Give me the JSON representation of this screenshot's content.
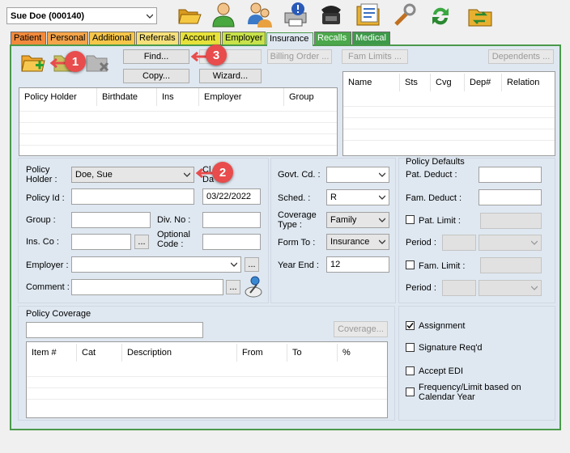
{
  "patient_selector": {
    "value": "Sue Doe (000140)"
  },
  "toolbar": {
    "icons": [
      "open-folder-icon",
      "patient-icon",
      "family-icon",
      "print-alert-icon",
      "phone-icon",
      "document-list-icon",
      "tools-icon",
      "refresh-icon",
      "transfer-folder-icon"
    ]
  },
  "tabs": [
    {
      "label": "Patient",
      "color": "#f28a3c"
    },
    {
      "label": "Personal",
      "color": "#f4a44a"
    },
    {
      "label": "Additional",
      "color": "#f6c64a"
    },
    {
      "label": "Referrals",
      "color": "#f6e07a"
    },
    {
      "label": "Account",
      "color": "#e6e23a"
    },
    {
      "label": "Employer",
      "color": "#c8e24a"
    },
    {
      "label": "Insurance",
      "color": "#dfe8f1"
    },
    {
      "label": "Recalls",
      "color": "#4aa84a"
    },
    {
      "label": "Medical",
      "color": "#3e9a4a"
    }
  ],
  "buttons": {
    "find": "Find...",
    "blank": "",
    "billing_order": "Billing Order ...",
    "fam_limits": "Fam Limits ...",
    "dependents": "Dependents ...",
    "copy": "Copy...",
    "wizard": "Wizard...",
    "coverage": "Coverage..."
  },
  "markers": {
    "one": "1",
    "two": "2",
    "three": "3"
  },
  "policy_grid": {
    "columns": [
      "Policy Holder",
      "Birthdate",
      "Ins",
      "Employer",
      "Group"
    ]
  },
  "dependents_grid": {
    "columns": [
      "Name",
      "Sts",
      "Cvg",
      "Dep#",
      "Relation"
    ]
  },
  "form": {
    "policy_holder_label_1": "Policy",
    "policy_holder_label_2": "Holder :",
    "policy_holder_value": "Doe, Sue",
    "policy_id_label": "Policy Id :",
    "policy_id_value": "",
    "date_value": "03/22/2022",
    "group_label": "Group :",
    "div_no_label": "Div. No :",
    "ins_co_label": "Ins. Co :",
    "optional_code_label_1": "Optional",
    "optional_code_label_2": "Code :",
    "employer_label": "Employer :",
    "comment_label": "Comment :",
    "partial_label_1": "Cl",
    "partial_label_2": "Da",
    "govt_cd_label": "Govt. Cd. :",
    "govt_cd_value": "",
    "sched_label": "Sched. :",
    "sched_value": "R",
    "coverage_type_label_1": "Coverage",
    "coverage_type_label_2": "Type :",
    "coverage_type_value": "Family",
    "form_to_label": "Form To :",
    "form_to_value": "Insurance",
    "year_end_label": "Year End :",
    "year_end_value": "12",
    "ellipsis": "..."
  },
  "policy_defaults": {
    "title": "Policy Defaults",
    "pat_deduct_label": "Pat. Deduct :",
    "fam_deduct_label": "Fam. Deduct :",
    "pat_limit_label": "Pat. Limit :",
    "period_label": "Period :",
    "fam_limit_label": "Fam. Limit :",
    "period2_label": "Period :"
  },
  "policy_coverage": {
    "title": "Policy Coverage",
    "columns": [
      "Item #",
      "Cat",
      "Description",
      "From",
      "To",
      "%"
    ]
  },
  "checkboxes": {
    "assignment": {
      "label": "Assignment",
      "checked": true
    },
    "signature": {
      "label": "Signature Req'd",
      "checked": false
    },
    "accept_edi": {
      "label": "Accept EDI",
      "checked": false
    },
    "frequency_1": "Frequency/Limit based on",
    "frequency_2": "Calendar Year"
  }
}
